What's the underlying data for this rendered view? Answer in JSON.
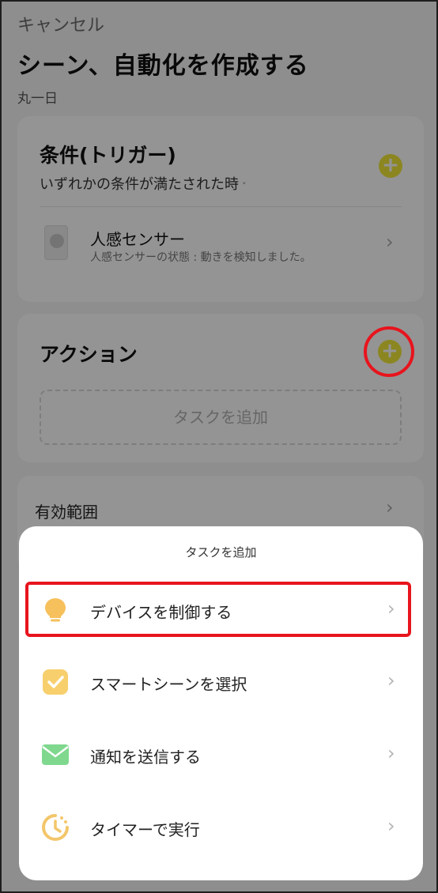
{
  "header": {
    "cancel_label": "キャンセル",
    "title": "シーン、自動化を作成する",
    "subtitle": "丸一日"
  },
  "condition": {
    "title": "条件(トリガー)",
    "mode": "いずれかの条件が満たされた時",
    "mode_caret": "˅",
    "plus": "+",
    "items": [
      {
        "name": "人感センサー",
        "description": "人感センサーの状態 : 動きを検知しました。",
        "chevron": "›"
      }
    ]
  },
  "action": {
    "title": "アクション",
    "plus": "+",
    "add_task_label": "タスクを追加"
  },
  "scope": {
    "label": "有効範囲",
    "chevron": "›"
  },
  "sheet": {
    "title": "タスクを追加",
    "options": [
      {
        "label": "デバイスを制御する",
        "icon": "lightbulb-icon",
        "chevron": "›"
      },
      {
        "label": "スマートシーンを選択",
        "icon": "checkbox-icon",
        "chevron": "›"
      },
      {
        "label": "通知を送信する",
        "icon": "envelope-icon",
        "chevron": "›"
      },
      {
        "label": "タイマーで実行",
        "icon": "clock-icon",
        "chevron": "›"
      }
    ]
  },
  "colors": {
    "accent_yellow": "#f2e73a",
    "highlight_red": "#e8141d",
    "bulb_orange": "#f6c05c",
    "scene_orange": "#f7cf6c",
    "mail_green": "#7fd88e",
    "timer_yellow": "#f3c66a"
  }
}
